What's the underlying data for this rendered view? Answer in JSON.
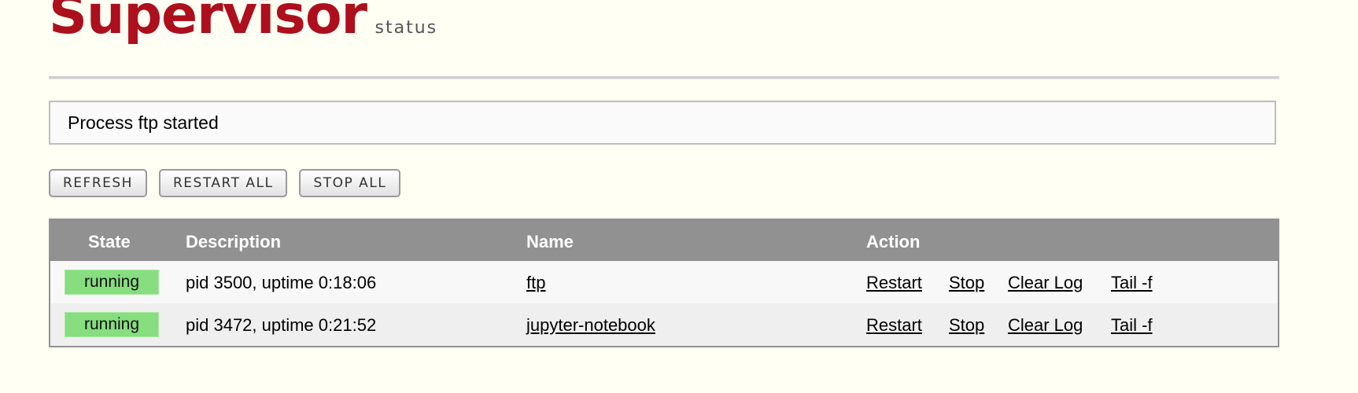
{
  "header": {
    "logo_text": "Supervisor",
    "logo_sub": "status"
  },
  "message": "Process ftp started",
  "buttons": {
    "refresh": "REFRESH",
    "restart_all": "RESTART ALL",
    "stop_all": "STOP ALL"
  },
  "table": {
    "headers": {
      "state": "State",
      "description": "Description",
      "name": "Name",
      "action": "Action"
    },
    "rows": [
      {
        "state": "running",
        "description": "pid 3500, uptime 0:18:06",
        "name": "ftp",
        "actions": [
          "Restart",
          "Stop",
          "Clear Log",
          "Tail -f"
        ]
      },
      {
        "state": "running",
        "description": "pid 3472, uptime 0:21:52",
        "name": "jupyter-notebook",
        "actions": [
          "Restart",
          "Stop",
          "Clear Log",
          "Tail -f"
        ]
      }
    ]
  },
  "colors": {
    "brand_red": "#ad0f1c",
    "running_green": "#86de7f",
    "header_gray": "#919191",
    "background": "#fffff4"
  }
}
